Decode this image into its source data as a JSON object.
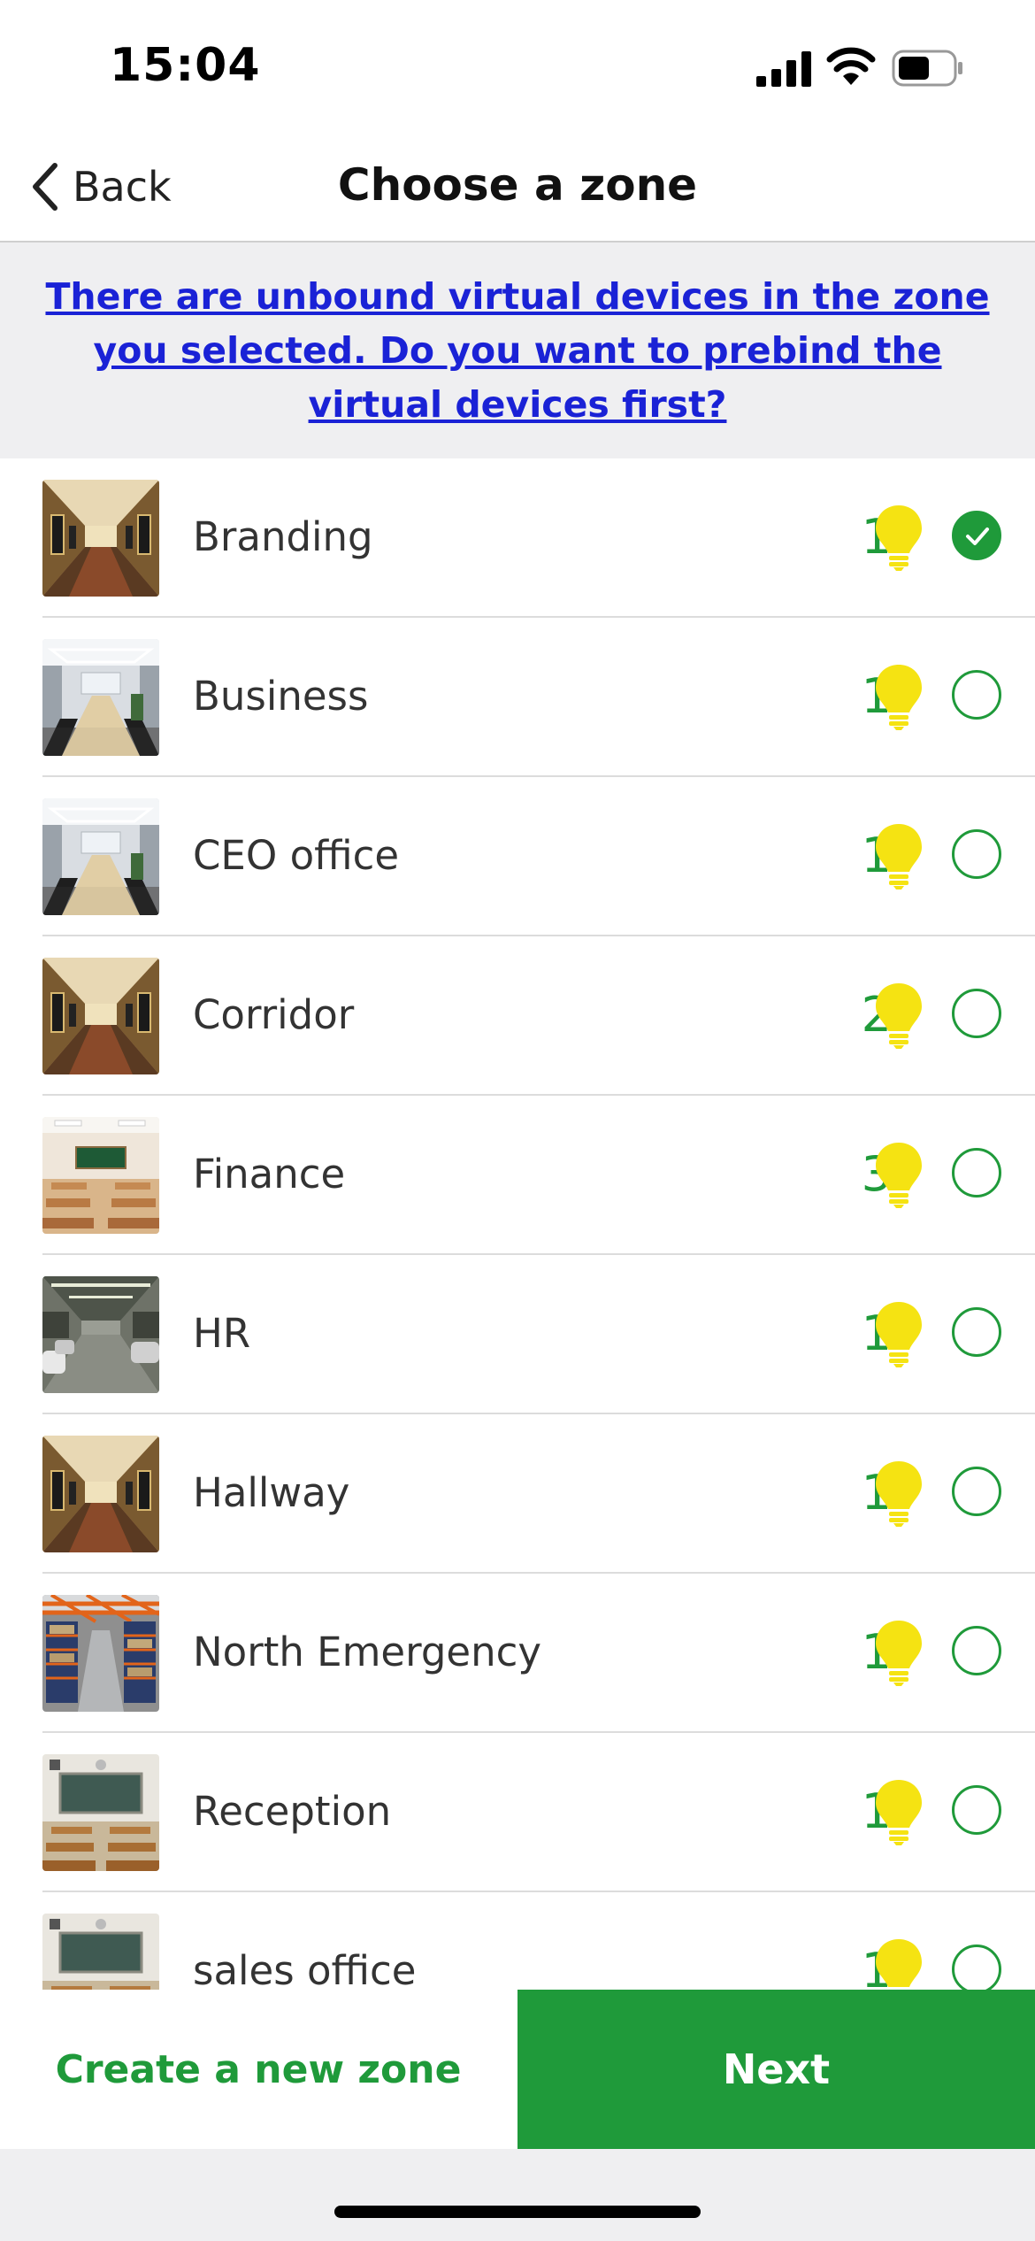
{
  "status_bar": {
    "time": "15:04"
  },
  "nav": {
    "back_label": "Back",
    "title": "Choose a zone"
  },
  "banner": {
    "text": "There are unbound virtual devices in the zone you selected. Do you want to prebind the virtual devices first?"
  },
  "colors": {
    "accent": "#1f9a3a",
    "link": "#1a22d6",
    "bulb": "#f5e312"
  },
  "zones": [
    {
      "name": "Branding",
      "count": "1",
      "thumb": "corridor",
      "selected": true
    },
    {
      "name": "Business",
      "count": "1",
      "thumb": "conference",
      "selected": false
    },
    {
      "name": "CEO office",
      "count": "1",
      "thumb": "conference",
      "selected": false
    },
    {
      "name": "Corridor",
      "count": "2",
      "thumb": "corridor",
      "selected": false
    },
    {
      "name": "Finance",
      "count": "3",
      "thumb": "classroom",
      "selected": false
    },
    {
      "name": "HR",
      "count": "1",
      "thumb": "parking",
      "selected": false
    },
    {
      "name": "Hallway",
      "count": "1",
      "thumb": "corridor",
      "selected": false
    },
    {
      "name": "North Emergency",
      "count": "1",
      "thumb": "warehouse",
      "selected": false
    },
    {
      "name": "Reception",
      "count": "1",
      "thumb": "classroom2",
      "selected": false
    },
    {
      "name": "sales office",
      "count": "1",
      "thumb": "classroom2",
      "selected": false
    }
  ],
  "bottom": {
    "create_label": "Create a new zone",
    "next_label": "Next"
  }
}
